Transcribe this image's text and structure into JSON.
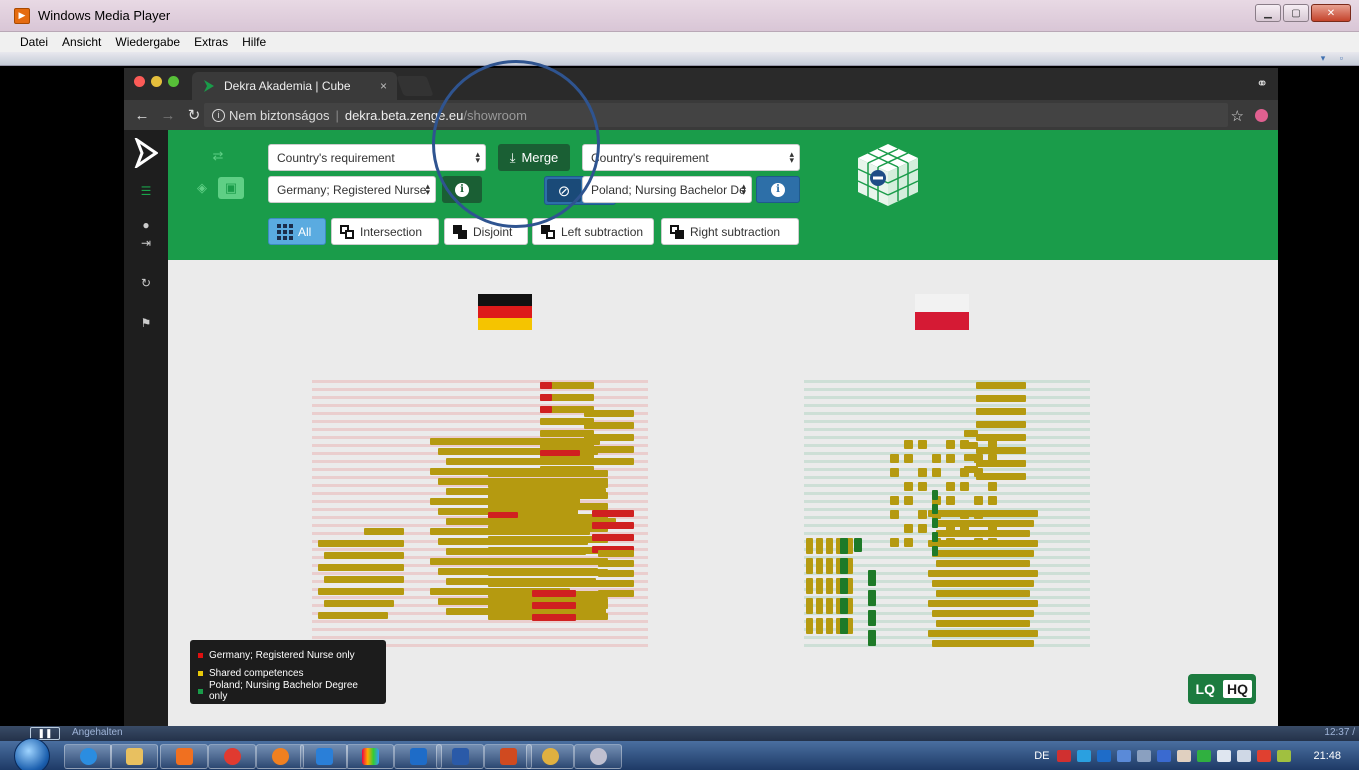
{
  "wmp": {
    "title": "Windows Media Player",
    "menu": [
      "Datei",
      "Ansicht",
      "Wiedergabe",
      "Extras",
      "Hilfe"
    ],
    "status": "Angehalten",
    "elapsed": "12:37 /"
  },
  "browser": {
    "tab_title": "Dekra Akademia | Cube",
    "tab_close": "×",
    "security": "Nem biztonságos",
    "url_host": "dekra.beta.zenge.eu",
    "url_path": "/showroom"
  },
  "toolbar": {
    "left_mode": "Country's requirement",
    "left_subject": "Germany; Registered Nurse",
    "merge_label": "Merge",
    "right_mode": "Country's requirement",
    "right_subject": "Poland; Nursing Bachelor De",
    "filters": [
      "All",
      "Intersection",
      "Disjoint",
      "Left subtraction",
      "Right subtraction"
    ],
    "active_filter": "All"
  },
  "legend": {
    "items": [
      {
        "label": "Germany; Registered Nurse only",
        "color": "#e01010"
      },
      {
        "label": "Shared competences",
        "color": "#e8c90a"
      },
      {
        "label": "Poland; Nursing Bachelor Degree only",
        "color": "#1a9c4a"
      }
    ]
  },
  "quality": {
    "lq": "LQ",
    "hq": "HQ",
    "selected": "HQ"
  },
  "colors": {
    "brand_green": "#1a9c4a",
    "shared": "#b59a10",
    "germany_only": "#d02020",
    "poland_only": "#1e7a28"
  },
  "taskbar": {
    "lang": "DE",
    "clock": "21:48",
    "apps": [
      "ie",
      "explorer",
      "media-player",
      "chrome",
      "firefox",
      "lync",
      "stats",
      "outlook",
      "word",
      "powerpoint",
      "paint",
      "misc"
    ]
  }
}
